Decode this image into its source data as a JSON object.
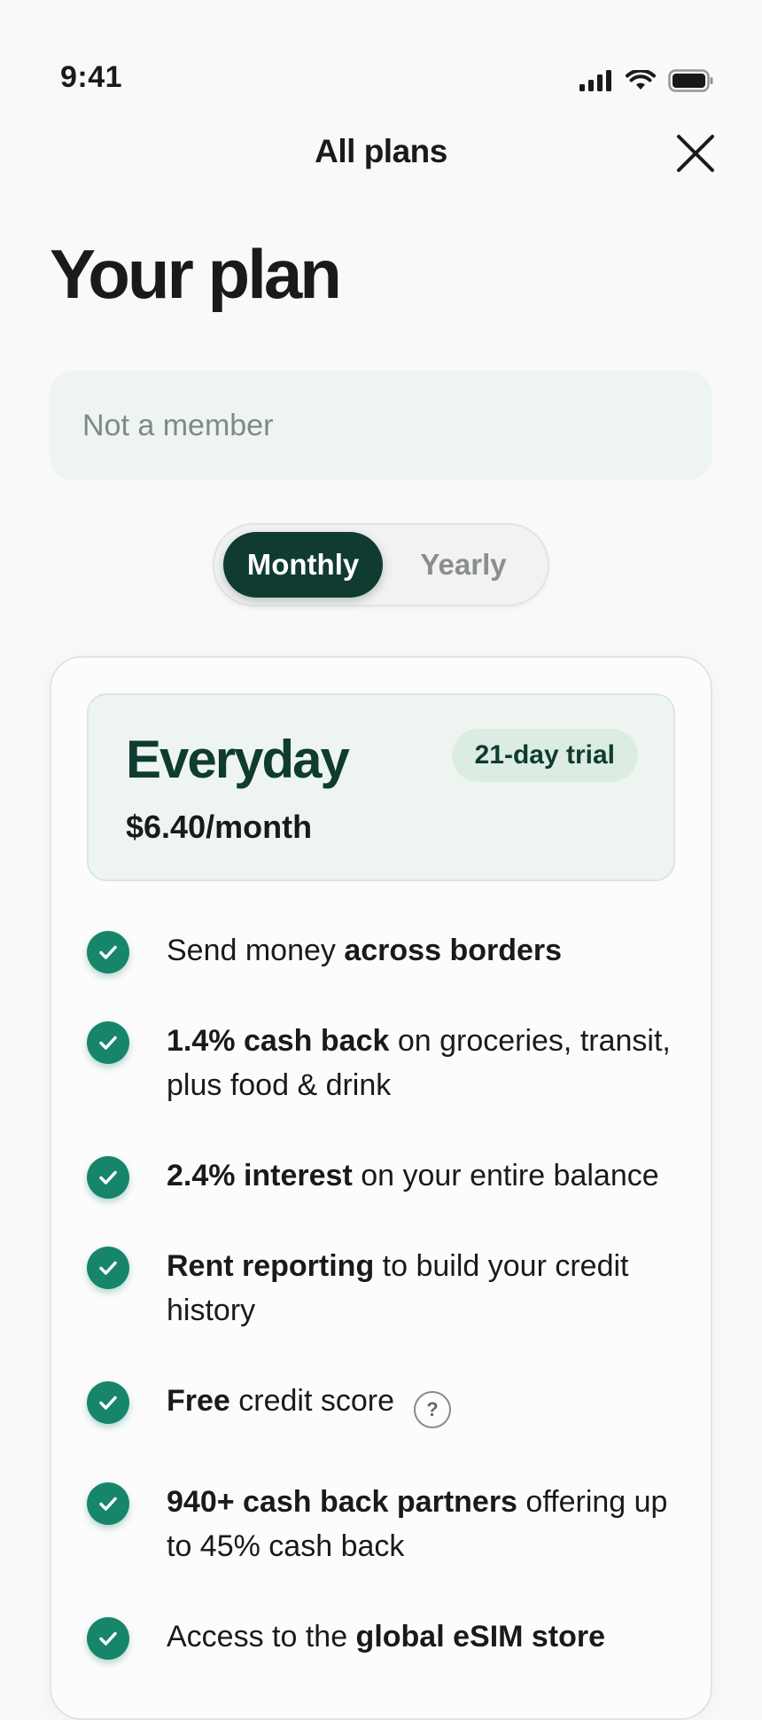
{
  "status_bar": {
    "time": "9:41"
  },
  "nav": {
    "title": "All plans"
  },
  "page": {
    "title": "Your plan"
  },
  "member_field": {
    "value": "Not a member"
  },
  "billing_toggle": {
    "monthly": "Monthly",
    "yearly": "Yearly",
    "selected": "Monthly"
  },
  "plan": {
    "name": "Everyday",
    "price": "$6.40/month",
    "badge": "21-day trial",
    "features": [
      {
        "pre": "Send money ",
        "bold": "across borders",
        "post": ""
      },
      {
        "pre": "",
        "bold": "1.4% cash back",
        "post": " on groceries, transit, plus food & drink"
      },
      {
        "pre": "",
        "bold": "2.4% interest",
        "post": " on your entire balance"
      },
      {
        "pre": "",
        "bold": "Rent reporting",
        "post": " to build your credit history"
      },
      {
        "pre": "",
        "bold": "Free",
        "post": " credit score",
        "help": "?"
      },
      {
        "pre": "",
        "bold": "940+ cash back partners",
        "post": " offering up to 45% cash back"
      },
      {
        "pre": "Access to the ",
        "bold": "global eSIM store",
        "post": ""
      }
    ]
  },
  "colors": {
    "accent": "#0f3b31",
    "check": "#17856a",
    "tint": "#eef5f1"
  }
}
